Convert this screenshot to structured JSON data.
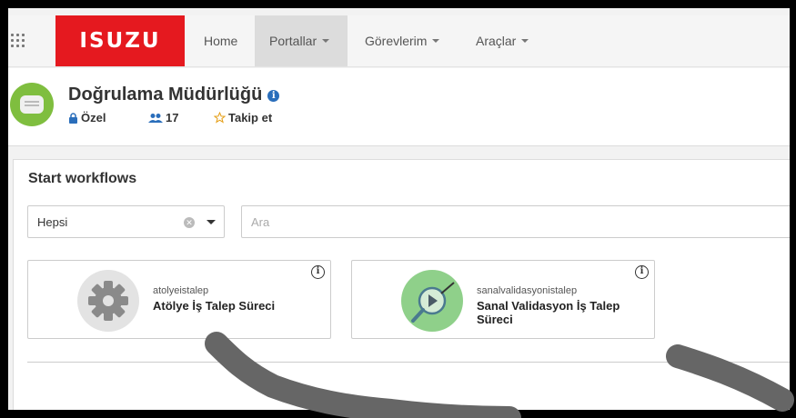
{
  "brand": {
    "logo_text": "ISUZU",
    "color": "#e5191f"
  },
  "nav": {
    "items": [
      {
        "label": "Home"
      },
      {
        "label": "Portallar"
      },
      {
        "label": "Görevlerim"
      },
      {
        "label": "Araçlar"
      }
    ],
    "active": "Portallar"
  },
  "group": {
    "title": "Doğrulama Müdürlüğü",
    "privacy": "Özel",
    "member_count": "17",
    "follow_label": "Takip et",
    "avatar_color": "#7fbe3f"
  },
  "workflows": {
    "title": "Start workflows",
    "filter_value": "Hepsi",
    "search_placeholder": "Ara",
    "cards": [
      {
        "id_text": "atolyeistalep",
        "name": "Atölye İş Talep Süreci",
        "icon": "gear-icon"
      },
      {
        "id_text": "sanalvalidasyonistalep",
        "name": "Sanal Validasyon İş Talep Süreci",
        "icon": "validation-play-icon"
      }
    ]
  }
}
